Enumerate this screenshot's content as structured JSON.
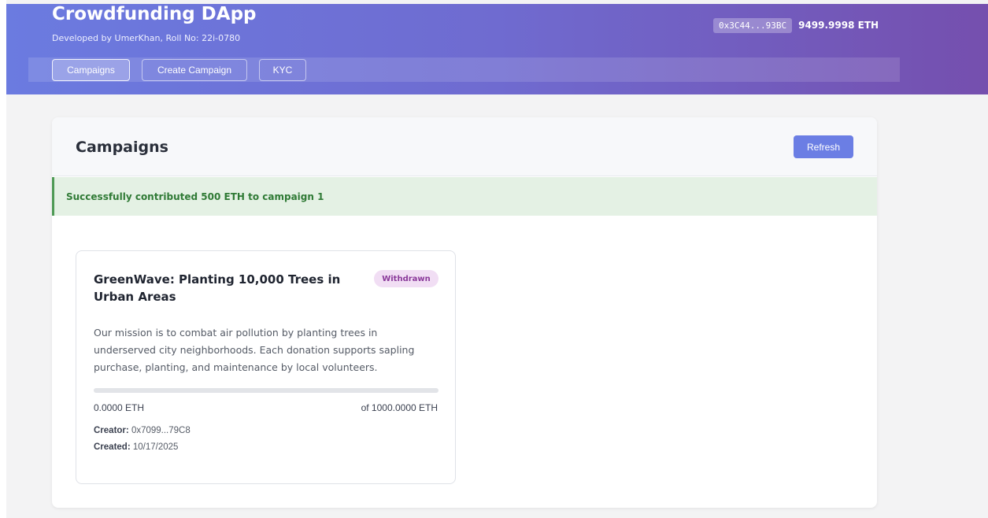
{
  "header": {
    "title": "Crowdfunding DApp",
    "subtitle": "Developed by UmerKhan, Roll No: 22i-0780",
    "wallet_address": "0x3C44...93BC",
    "balance": "9499.9998 ETH",
    "nav": [
      {
        "label": "Campaigns",
        "active": true
      },
      {
        "label": "Create Campaign",
        "active": false
      },
      {
        "label": "KYC",
        "active": false
      }
    ]
  },
  "main": {
    "title": "Campaigns",
    "refresh_label": "Refresh",
    "alert": "Successfully contributed 500 ETH to campaign 1",
    "campaigns": [
      {
        "title": "GreenWave: Planting 10,000 Trees in Urban Areas",
        "status": "Withdrawn",
        "description": "Our mission is to combat air pollution by planting trees in underserved city neighborhoods. Each donation supports sapling purchase, planting, and maintenance by local volunteers.",
        "raised": "0.0000 ETH",
        "goal": "of 1000.0000 ETH",
        "progress_fraction": 0,
        "creator_label": "Creator:",
        "creator": "0x7099...79C8",
        "created_label": "Created:",
        "created": "10/17/2025"
      }
    ]
  },
  "colors": {
    "accent": "#6b7ee4",
    "success_bg": "#e4f1e4",
    "success_text": "#2f7a35",
    "badge_bg": "#f1def4",
    "badge_text": "#8a3a9a"
  }
}
